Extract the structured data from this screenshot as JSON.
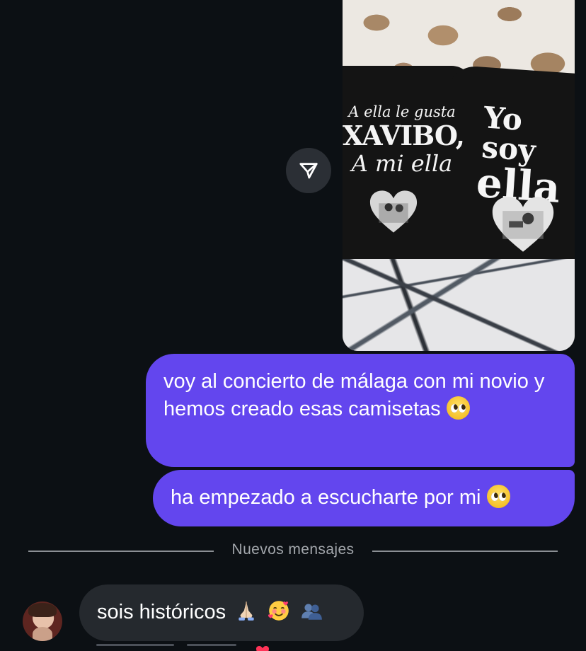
{
  "colors": {
    "background": "#0c1014",
    "outgoing_bubble": "#6346ee",
    "incoming_bubble": "#25292e",
    "divider": "#8b8f94"
  },
  "shared_photo": {
    "left_shirt_line1": "A ella le gusta",
    "left_shirt_line2": "XAVIBO,",
    "left_shirt_line3": "A mi ella",
    "right_shirt_line1": "Yo soy",
    "right_shirt_line2": "ella"
  },
  "share_button_icon": "send-icon",
  "messages": [
    {
      "direction": "outgoing",
      "text": "voy al concierto de málaga con mi novio y hemos creado esas camisetas",
      "emoji_icon": "pleading-face-icon"
    },
    {
      "direction": "outgoing",
      "text": "ha empezado a escucharte por mi",
      "emoji_icon": "pleading-face-icon"
    }
  ],
  "divider": {
    "label": "Nuevos mensajes"
  },
  "incoming": {
    "avatar_icon": "avatar",
    "text": "sois históricos",
    "emoji_icons": [
      "folded-hands-icon",
      "smiling-face-with-hearts-icon",
      "busts-icon"
    ]
  }
}
